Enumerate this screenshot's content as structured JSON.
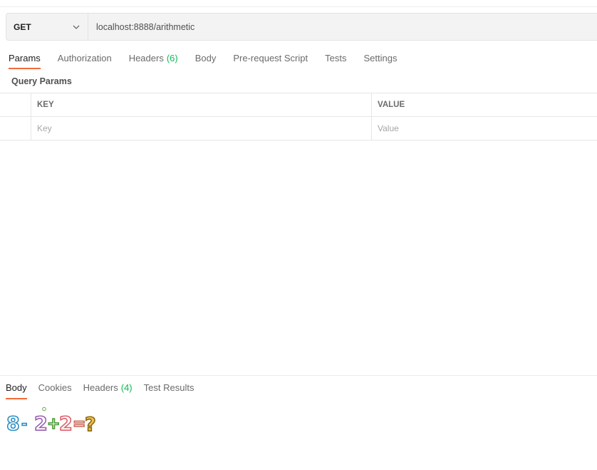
{
  "request": {
    "method": "GET",
    "url": "localhost:8888/arithmetic"
  },
  "request_tabs": [
    {
      "label": "Params",
      "count": ""
    },
    {
      "label": "Authorization",
      "count": ""
    },
    {
      "label": "Headers",
      "count": "(6)"
    },
    {
      "label": "Body",
      "count": ""
    },
    {
      "label": "Pre-request Script",
      "count": ""
    },
    {
      "label": "Tests",
      "count": ""
    },
    {
      "label": "Settings",
      "count": ""
    }
  ],
  "query_params": {
    "title": "Query Params",
    "columns": {
      "key": "KEY",
      "value": "VALUE"
    },
    "placeholders": {
      "key": "Key",
      "value": "Value"
    }
  },
  "response_tabs": [
    {
      "label": "Body",
      "count": ""
    },
    {
      "label": "Cookies",
      "count": ""
    },
    {
      "label": "Headers",
      "count": "(4)"
    },
    {
      "label": "Test Results",
      "count": ""
    }
  ],
  "response_body": {
    "captcha_text": "8-2+2=?"
  },
  "colors": {
    "accent": "#f26b3a",
    "count_green": "#0cbb52"
  }
}
